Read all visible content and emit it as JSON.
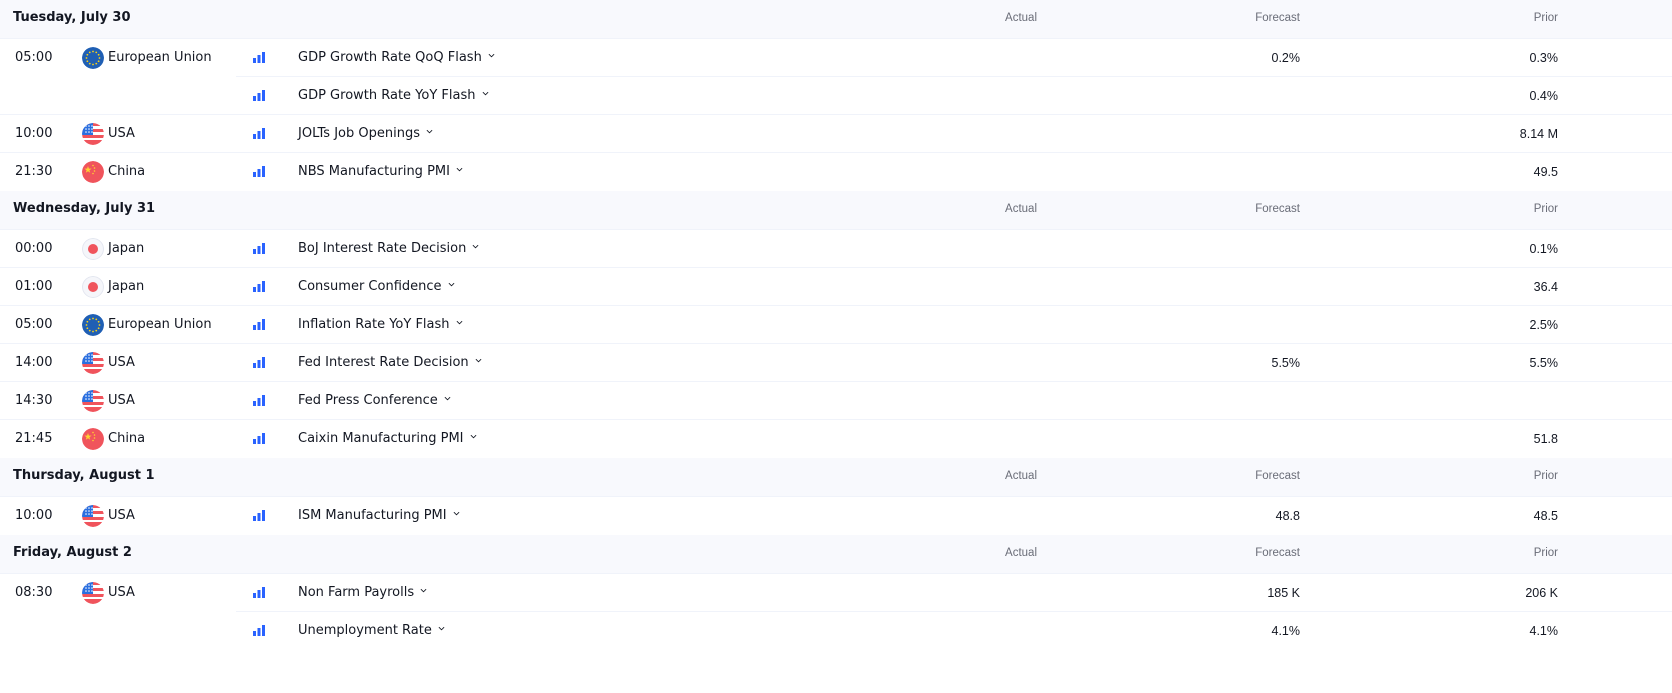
{
  "columns": {
    "actual": "Actual",
    "forecast": "Forecast",
    "prior": "Prior"
  },
  "colors": {
    "importance_bars": "#2962ff",
    "header_bg": "#f8f9fd",
    "separator": "#f0f3fa"
  },
  "days": [
    {
      "title": "Tuesday, July 30",
      "events": [
        {
          "time": "05:00",
          "country": "European Union",
          "flag": "eu-flag-icon",
          "name": "GDP Growth Rate QoQ Flash",
          "actual": "",
          "forecast": "0.2%",
          "prior": "0.3%",
          "continued": false
        },
        {
          "time": "",
          "country": "",
          "flag": "",
          "name": "GDP Growth Rate YoY Flash",
          "actual": "",
          "forecast": "",
          "prior": "0.4%",
          "continued": true
        },
        {
          "time": "10:00",
          "country": "USA",
          "flag": "us-flag-icon",
          "name": "JOLTs Job Openings",
          "actual": "",
          "forecast": "",
          "prior": "8.14 M",
          "continued": false
        },
        {
          "time": "21:30",
          "country": "China",
          "flag": "china-flag-icon",
          "name": "NBS Manufacturing PMI",
          "actual": "",
          "forecast": "",
          "prior": "49.5",
          "continued": false
        }
      ]
    },
    {
      "title": "Wednesday, July 31",
      "events": [
        {
          "time": "00:00",
          "country": "Japan",
          "flag": "japan-flag-icon",
          "name": "BoJ Interest Rate Decision",
          "actual": "",
          "forecast": "",
          "prior": "0.1%",
          "continued": false
        },
        {
          "time": "01:00",
          "country": "Japan",
          "flag": "japan-flag-icon",
          "name": "Consumer Confidence",
          "actual": "",
          "forecast": "",
          "prior": "36.4",
          "continued": false
        },
        {
          "time": "05:00",
          "country": "European Union",
          "flag": "eu-flag-icon",
          "name": "Inflation Rate YoY Flash",
          "actual": "",
          "forecast": "",
          "prior": "2.5%",
          "continued": false
        },
        {
          "time": "14:00",
          "country": "USA",
          "flag": "us-flag-icon",
          "name": "Fed Interest Rate Decision",
          "actual": "",
          "forecast": "5.5%",
          "prior": "5.5%",
          "continued": false
        },
        {
          "time": "14:30",
          "country": "USA",
          "flag": "us-flag-icon",
          "name": "Fed Press Conference",
          "actual": "",
          "forecast": "",
          "prior": "",
          "continued": false
        },
        {
          "time": "21:45",
          "country": "China",
          "flag": "china-flag-icon",
          "name": "Caixin Manufacturing PMI",
          "actual": "",
          "forecast": "",
          "prior": "51.8",
          "continued": false
        }
      ]
    },
    {
      "title": "Thursday, August 1",
      "events": [
        {
          "time": "10:00",
          "country": "USA",
          "flag": "us-flag-icon",
          "name": "ISM Manufacturing PMI",
          "actual": "",
          "forecast": "48.8",
          "prior": "48.5",
          "continued": false
        }
      ]
    },
    {
      "title": "Friday, August 2",
      "events": [
        {
          "time": "08:30",
          "country": "USA",
          "flag": "us-flag-icon",
          "name": "Non Farm Payrolls",
          "actual": "",
          "forecast": "185 K",
          "prior": "206 K",
          "continued": false
        },
        {
          "time": "",
          "country": "",
          "flag": "",
          "name": "Unemployment Rate",
          "actual": "",
          "forecast": "4.1%",
          "prior": "4.1%",
          "continued": true
        }
      ]
    }
  ]
}
